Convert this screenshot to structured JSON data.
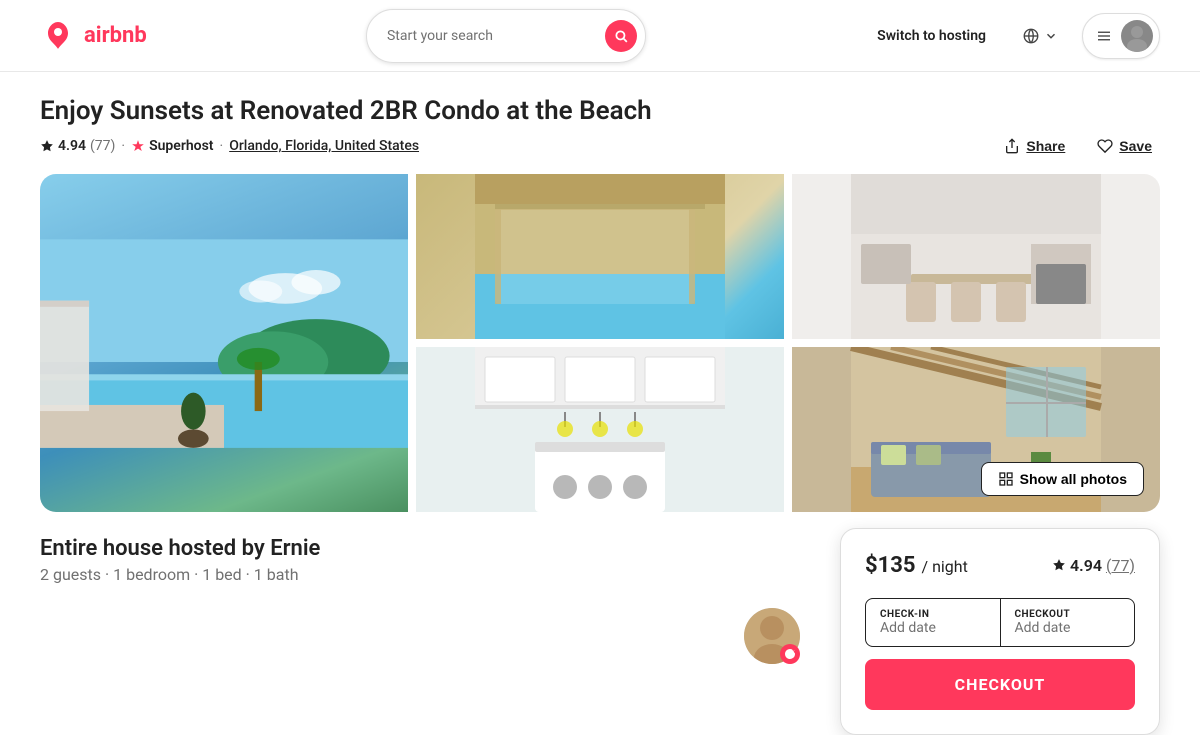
{
  "header": {
    "logo_text": "airbnb",
    "search_placeholder": "Start your search",
    "switch_hosting_label": "Switch to hosting",
    "globe_label": "Language"
  },
  "listing": {
    "title": "Enjoy Sunsets at Renovated 2BR Condo at the Beach",
    "rating": "4.94",
    "review_count": "(77)",
    "superhost_label": "Superhost",
    "location": "Orlando, Florida, United States",
    "share_label": "Share",
    "save_label": "Save",
    "show_photos_label": "Show all photos",
    "host_name": "Ernie",
    "host_title_prefix": "Entire house hosted by",
    "host_details": "2 guests · 1 bedroom · 1 bed · 1 bath",
    "price": "$135",
    "per_night": "/ night",
    "card_rating": "4.94",
    "card_reviews": "77",
    "checkin_label": "CHECK-IN",
    "checkout_label": "CHECKOUT",
    "checkout_btn": "CHECKOUT"
  },
  "photos": [
    {
      "id": "main",
      "color": "#87ceeb",
      "alt": "Beach pool view"
    },
    {
      "id": "top-mid",
      "color": "#d4c5a0",
      "alt": "Modern house exterior"
    },
    {
      "id": "top-right",
      "color": "#e8e0d8",
      "alt": "Living room interior"
    },
    {
      "id": "bot-mid",
      "color": "#dde8e8",
      "alt": "Kitchen interior"
    },
    {
      "id": "bot-right",
      "color": "#c8b898",
      "alt": "Loft interior"
    }
  ]
}
